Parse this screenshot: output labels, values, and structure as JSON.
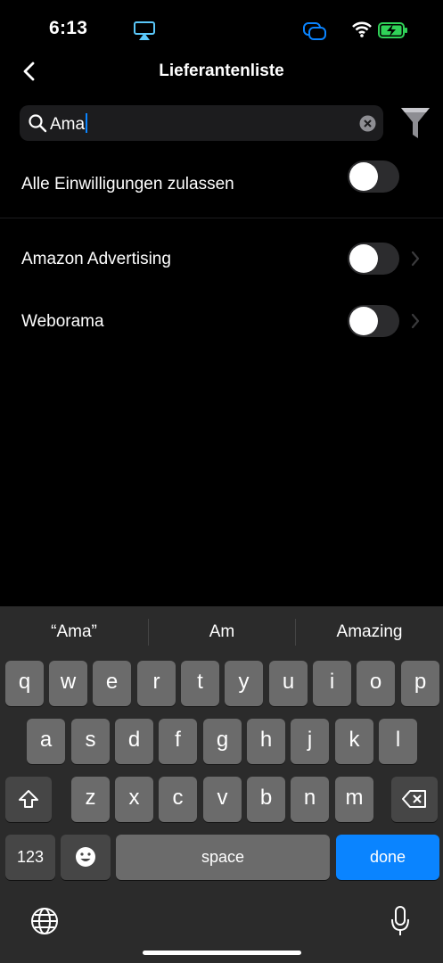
{
  "status_bar": {
    "time": "6:13"
  },
  "nav": {
    "title": "Lieferantenliste"
  },
  "search": {
    "value": "Ama"
  },
  "consent_all": {
    "label": "Alle Einwilligungen zulassen",
    "enabled": false
  },
  "vendors": [
    {
      "label": "Amazon Advertising",
      "enabled": false
    },
    {
      "label": "Weborama",
      "enabled": false
    }
  ],
  "keyboard": {
    "suggestions": [
      "“Ama”",
      "Am",
      "Amazing"
    ],
    "row1": [
      "q",
      "w",
      "e",
      "r",
      "t",
      "y",
      "u",
      "i",
      "o",
      "p"
    ],
    "row2": [
      "a",
      "s",
      "d",
      "f",
      "g",
      "h",
      "j",
      "k",
      "l"
    ],
    "row3": [
      "z",
      "x",
      "c",
      "v",
      "b",
      "n",
      "m"
    ],
    "numbers_label": "123",
    "space_label": "space",
    "done_label": "done"
  },
  "colors": {
    "accent": "#0a84ff",
    "battery": "#30d158",
    "background": "#000000"
  }
}
